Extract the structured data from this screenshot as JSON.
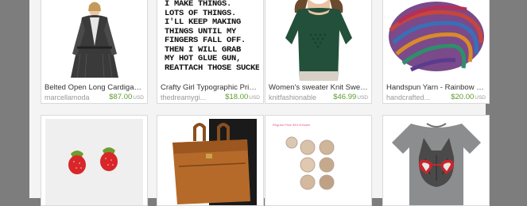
{
  "listings": [
    {
      "title": "Belted Open Long Cardigan /...",
      "shop": "marcellamoda",
      "price": "$87.00",
      "currency": "USD"
    },
    {
      "title": "Crafty Girl Typographic Print. ...",
      "shop": "thedreamygi...",
      "price": "$18.00",
      "currency": "USD"
    },
    {
      "title": "Women's sweater Knit Sweat...",
      "shop": "knitfashionable",
      "price": "$46.99",
      "currency": "USD"
    },
    {
      "title": "Handspun Yarn - Rainbow M...",
      "shop": "handcrafted...",
      "price": "$20.00",
      "currency": "USD"
    }
  ],
  "poster": {
    "lines": "I MAKE THINGS.\nLOTS OF THINGS.\nI'LL KEEP MAKING\nTHINGS UNTIL MY\nFINGERS FALL OFF.\nTHEN I WILL GRAB\nMY HOT GLUE GUN,\nREATTACH THOSE SUCKERS"
  },
  "second_row_labels": {
    "cosmetics_tag": "Regular Price $10.00/each"
  },
  "icons": [
    "cardigan-photo",
    "typography-poster",
    "green-sweater-photo",
    "rainbow-yarn-photo",
    "strawberry-earrings-photo",
    "leather-bag-photo",
    "mineral-makeup-photo",
    "cat-tshirt-photo"
  ],
  "colors": {
    "price_green": "#5d9c2d",
    "background_gray": "#7d7d7d"
  }
}
